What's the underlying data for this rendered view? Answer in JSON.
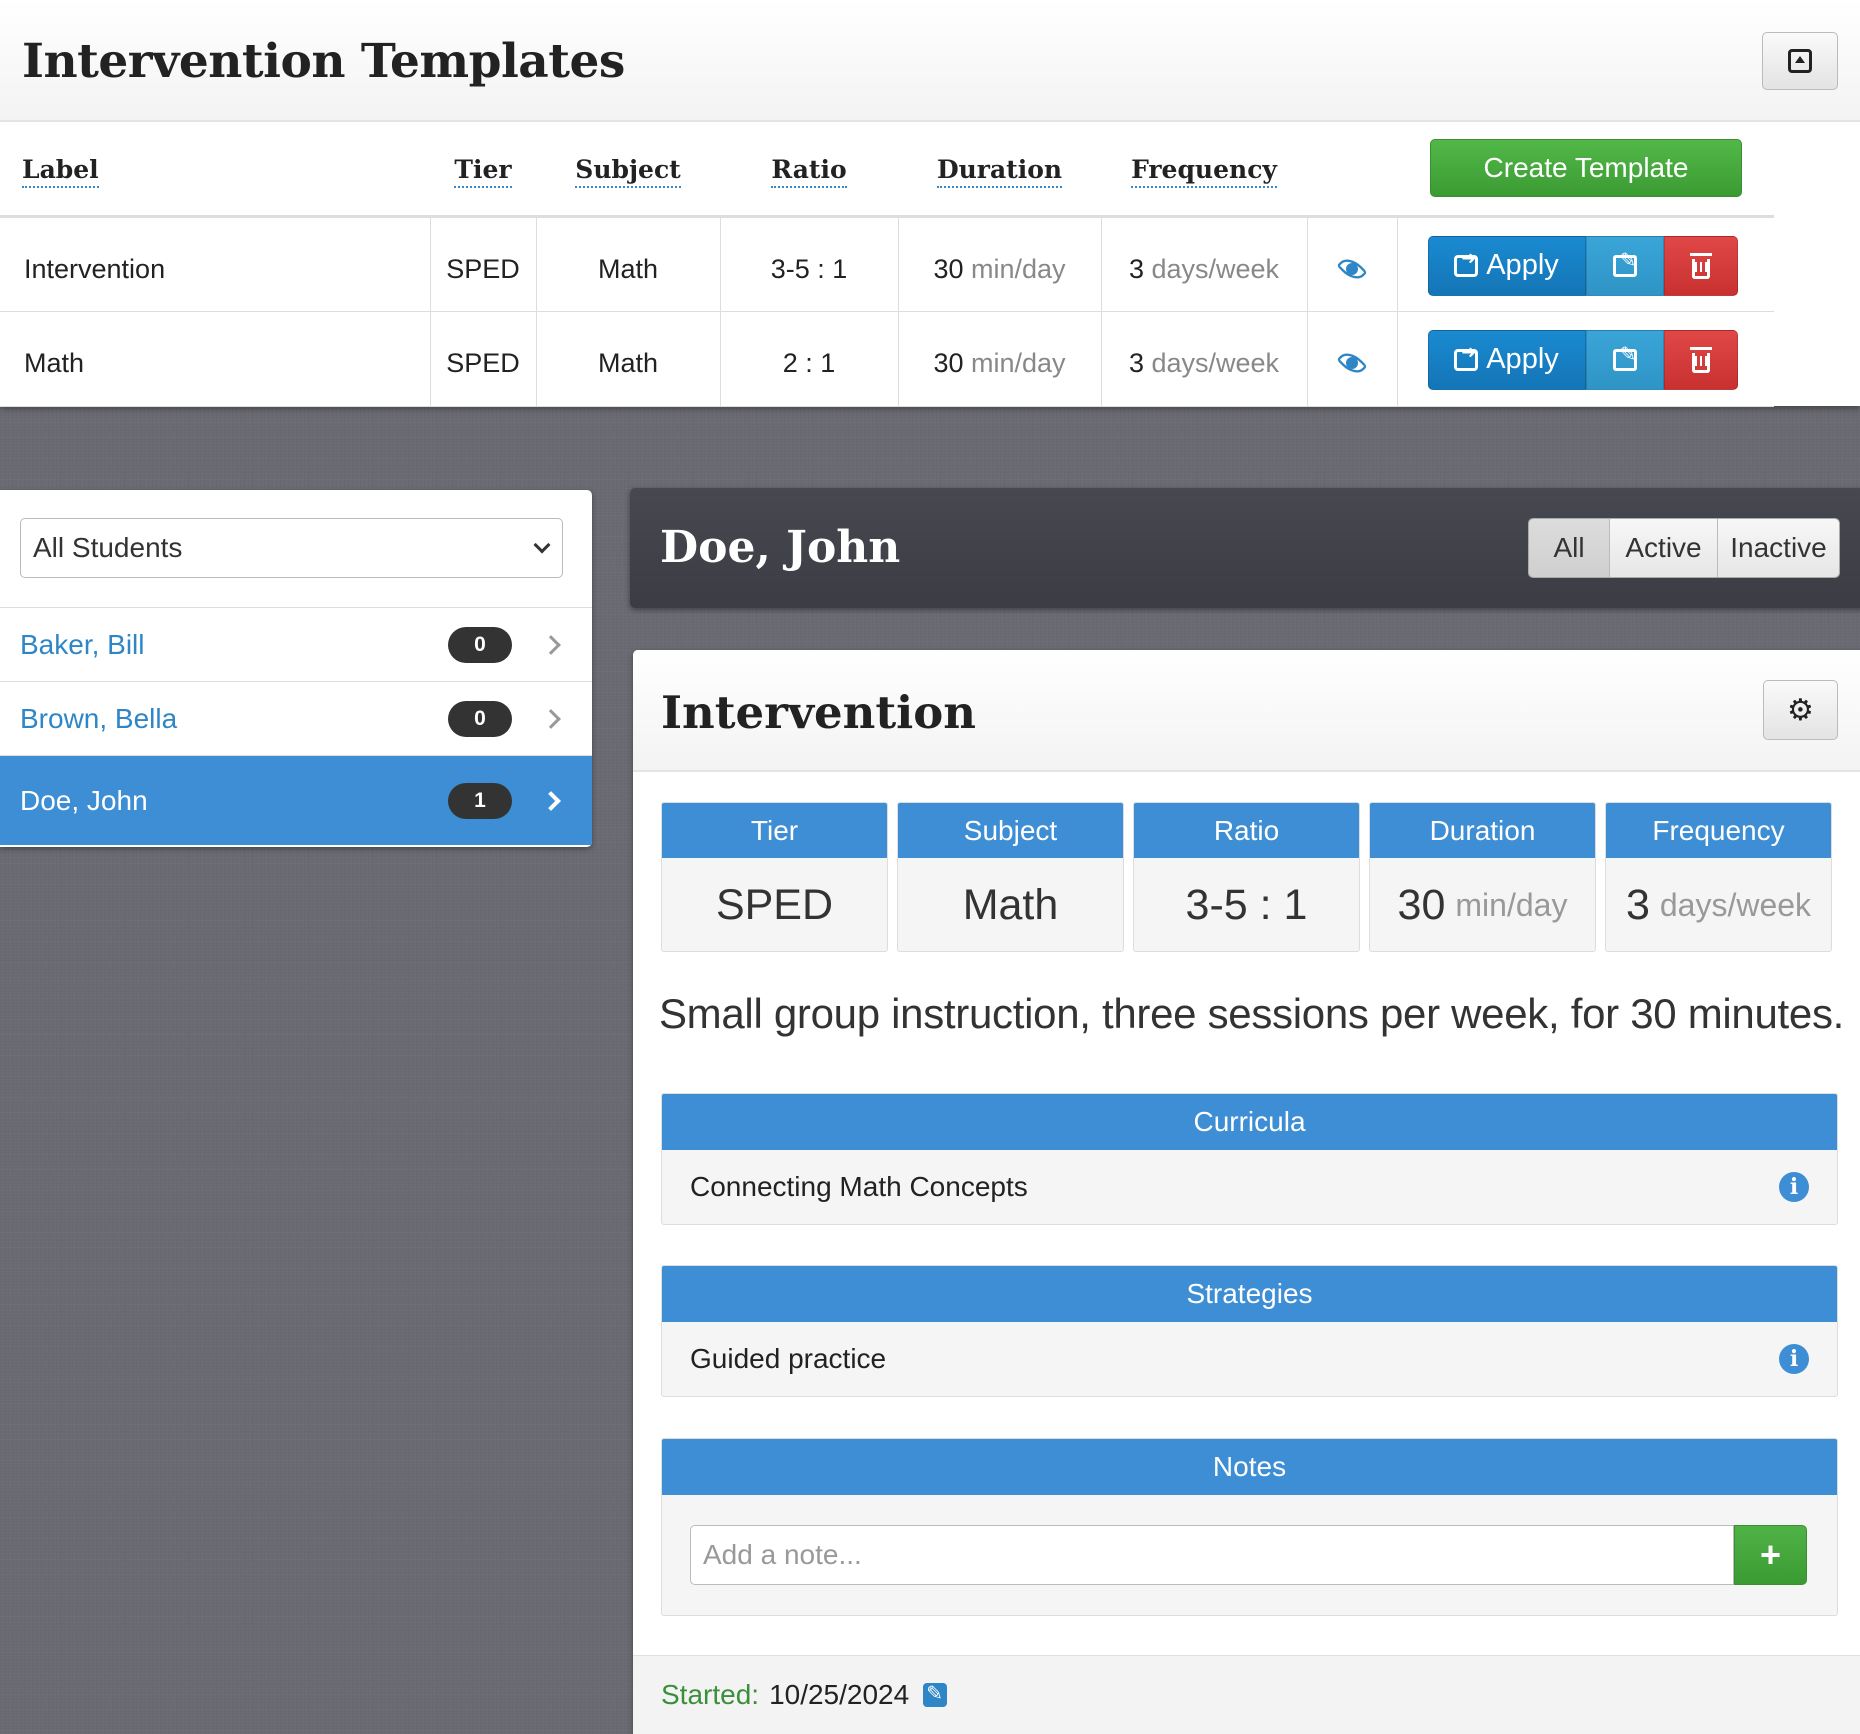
{
  "templates": {
    "title": "Intervention Templates",
    "create_label": "Create Template",
    "columns": {
      "label": "Label",
      "tier": "Tier",
      "subject": "Subject",
      "ratio": "Ratio",
      "duration": "Duration",
      "frequency": "Frequency"
    },
    "rows": [
      {
        "label": "Intervention",
        "tier": "SPED",
        "subject": "Math",
        "ratio": "3-5 : 1",
        "duration_value": "30",
        "duration_unit": "min/day",
        "frequency_value": "3",
        "frequency_unit": "days/week",
        "apply_label": "Apply"
      },
      {
        "label": "Math",
        "tier": "SPED",
        "subject": "Math",
        "ratio": "2 : 1",
        "duration_value": "30",
        "duration_unit": "min/day",
        "frequency_value": "3",
        "frequency_unit": "days/week",
        "apply_label": "Apply"
      }
    ]
  },
  "students": {
    "filter_value": "All Students",
    "items": [
      {
        "name": "Baker, Bill",
        "count": "0",
        "active": false
      },
      {
        "name": "Brown, Bella",
        "count": "0",
        "active": false
      },
      {
        "name": "Doe, John",
        "count": "1",
        "active": true
      }
    ]
  },
  "student_header": {
    "name": "Doe, John",
    "filters": [
      "All",
      "Active",
      "Inactive"
    ],
    "selected_filter": "All"
  },
  "intervention": {
    "title": "Intervention",
    "stats": [
      {
        "label": "Tier",
        "value": "SPED",
        "unit": ""
      },
      {
        "label": "Subject",
        "value": "Math",
        "unit": ""
      },
      {
        "label": "Ratio",
        "value": "3-5 : 1",
        "unit": ""
      },
      {
        "label": "Duration",
        "value": "30",
        "unit": "min/day"
      },
      {
        "label": "Frequency",
        "value": "3",
        "unit": "days/week"
      }
    ],
    "description": "Small group instruction, three sessions per week, for 30 minutes.",
    "curricula": {
      "title": "Curricula",
      "items": [
        "Connecting Math Concepts"
      ]
    },
    "strategies": {
      "title": "Strategies",
      "items": [
        "Guided practice"
      ]
    },
    "notes": {
      "title": "Notes",
      "placeholder": "Add a note...",
      "add_label": "+"
    },
    "started_label": "Started:",
    "started_date": "10/25/2024"
  },
  "colors": {
    "primary": "#3d8ed4",
    "success": "#3b9b33",
    "danger": "#c93030",
    "dark_header": "#3b3c44"
  }
}
